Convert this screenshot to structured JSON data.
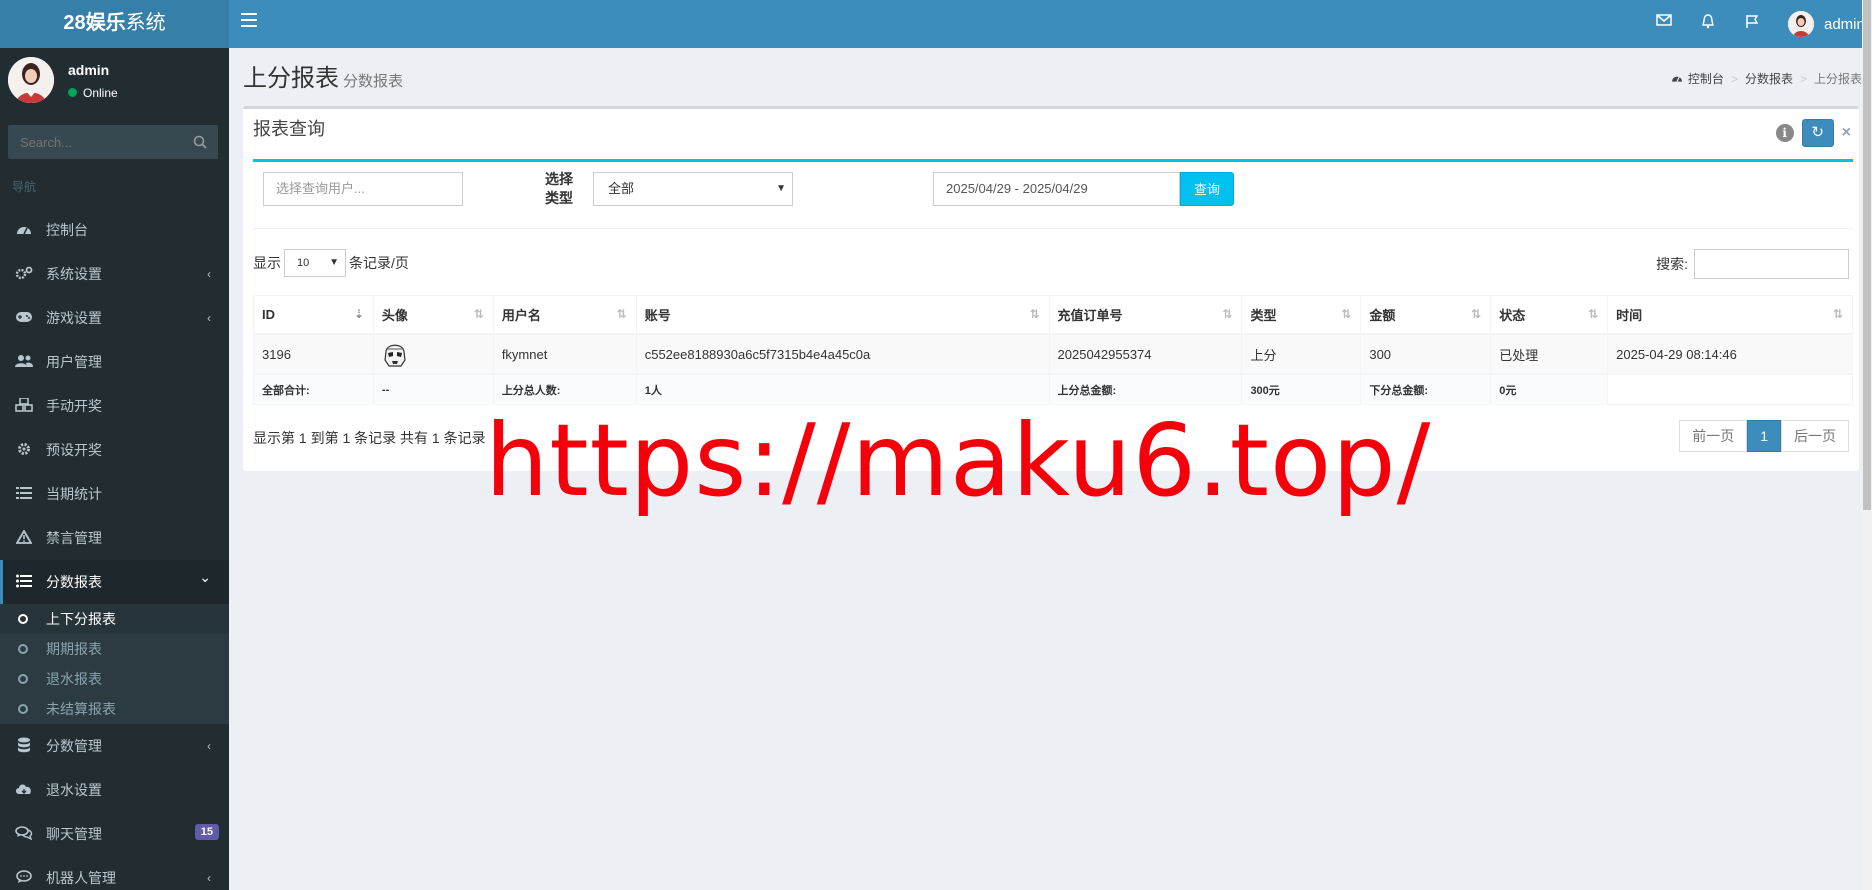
{
  "app": {
    "logo_bold": "28娱乐",
    "logo_rest": "系统",
    "user": "admin"
  },
  "sidebar": {
    "user_name": "admin",
    "status": "Online",
    "search_placeholder": "Search...",
    "header": "导航",
    "items": [
      {
        "label": "控制台",
        "icon": "dashboard-icon"
      },
      {
        "label": "系统设置",
        "icon": "cogs-icon",
        "arrow": "‹"
      },
      {
        "label": "游戏设置",
        "icon": "gamepad-icon",
        "arrow": "‹"
      },
      {
        "label": "用户管理",
        "icon": "users-icon"
      },
      {
        "label": "手动开奖",
        "icon": "cubes-icon"
      },
      {
        "label": "预设开奖",
        "icon": "gear-icon"
      },
      {
        "label": "当期统计",
        "icon": "list-icon"
      },
      {
        "label": "禁言管理",
        "icon": "warning-icon"
      },
      {
        "label": "分数报表",
        "icon": "list-ul-icon",
        "arrow": "⌄"
      }
    ],
    "sub_items": [
      "上下分报表",
      "期期报表",
      "退水报表",
      "未结算报表"
    ],
    "items_after": [
      {
        "label": "分数管理",
        "icon": "database-icon",
        "arrow": "‹"
      },
      {
        "label": "退水设置",
        "icon": "cloud-icon"
      },
      {
        "label": "聊天管理",
        "icon": "comments-icon",
        "badge": "15"
      },
      {
        "label": "机器人管理",
        "icon": "comment-icon",
        "arrow": "‹"
      }
    ]
  },
  "page": {
    "title": "上分报表",
    "subtitle": "分数报表",
    "breadcrumb": [
      "控制台",
      "分数报表",
      "上分报表"
    ]
  },
  "box": {
    "title": "报表查询",
    "refresh": "↻",
    "close": "×"
  },
  "filter": {
    "user_placeholder": "选择查询用户...",
    "type_label": "选择类型",
    "type_value": "全部",
    "date_range": "2025/04/29 - 2025/04/29",
    "query_button": "查询"
  },
  "table_controls": {
    "show_prefix": "显示",
    "page_size": "10",
    "show_suffix": "条记录/页",
    "search_label": "搜索:"
  },
  "table": {
    "headers": [
      "ID",
      "头像",
      "用户名",
      "账号",
      "充值订单号",
      "类型",
      "金额",
      "状态",
      "时间"
    ],
    "rows": [
      {
        "id": "3196",
        "avatar": "stormtrooper-avatar",
        "username": "fkymnet",
        "account": "c552ee8188930a6c5f7315b4e4a45c0a",
        "order": "2025042955374",
        "type": "上分",
        "amount": "300",
        "status": "已处理",
        "time": "2025-04-29 08:14:46"
      }
    ],
    "footer": {
      "total_label": "全部合计:",
      "total_value": "--",
      "up_users_label": "上分总人数:",
      "up_users_value": "1人",
      "up_amount_label": "上分总金额:",
      "up_amount_value": "300元",
      "down_amount_label": "下分总金额:",
      "down_amount_value": "0元"
    }
  },
  "pagination": {
    "info": "显示第 1 到第 1 条记录 共有 1 条记录",
    "prev": "前一页",
    "current": "1",
    "next": "后一页"
  },
  "watermark": "https://maku6.top/"
}
